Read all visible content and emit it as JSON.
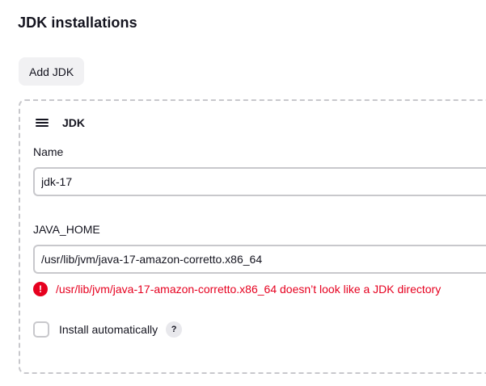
{
  "section": {
    "title": "JDK installations",
    "add_button_label": "Add JDK"
  },
  "jdk_item": {
    "title": "JDK",
    "drag_icon": "drag-handle-icon",
    "name_field": {
      "label": "Name",
      "value": "jdk-17"
    },
    "java_home_field": {
      "label": "JAVA_HOME",
      "value": "/usr/lib/jvm/java-17-amazon-corretto.x86_64"
    },
    "error": {
      "icon": "error-icon",
      "icon_glyph": "!",
      "message": "/usr/lib/jvm/java-17-amazon-corretto.x86_64 doesn’t look like a JDK directory",
      "color": "#e6001f"
    },
    "install_automatically": {
      "label": "Install automatically",
      "checked": false,
      "help_glyph": "?"
    }
  }
}
